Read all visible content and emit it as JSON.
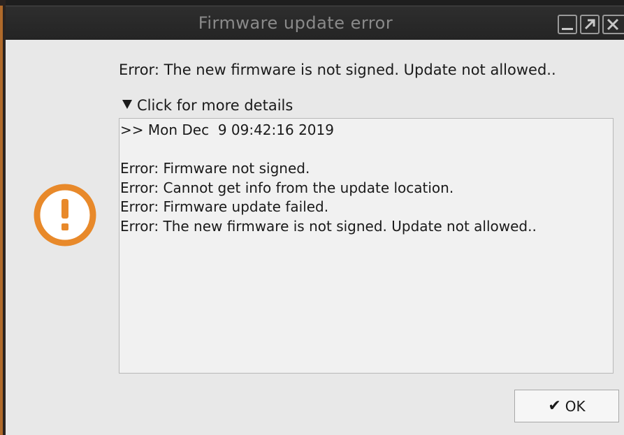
{
  "window": {
    "title": "Firmware update error",
    "controls": {
      "minimize_icon": "minimize-icon",
      "maximize_icon": "maximize-icon",
      "close_icon": "close-icon"
    }
  },
  "dialog": {
    "message": "Error: The new firmware is not signed. Update not allowed..",
    "details_toggle_label": "Click for more details",
    "details_expanded": true,
    "details_lines": [
      ">> Mon Dec  9 09:42:16 2019",
      "",
      "Error: Firmware not signed.",
      "Error: Cannot get info from the update location.",
      "Error: Firmware update failed.",
      "Error: The new firmware is not signed. Update not allowed.."
    ],
    "icon": "warning-icon",
    "ok_label": "OK",
    "ok_icon": "check-icon"
  },
  "colors": {
    "warning_orange": "#e8892a",
    "titlebar_bg": "#262626",
    "title_text": "#8a8a8a",
    "dialog_bg": "#e8e8e8"
  }
}
